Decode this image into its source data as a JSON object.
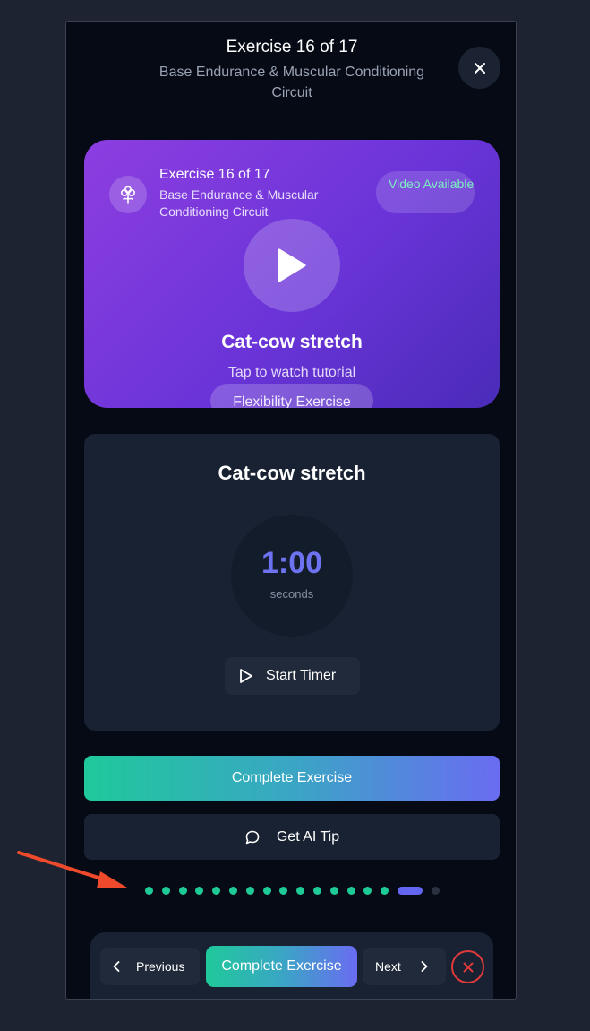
{
  "header": {
    "title": "Exercise 16 of 17",
    "subtitle": "Base Endurance & Muscular Conditioning Circuit"
  },
  "hero": {
    "title": "Exercise 16 of 17",
    "subtitle": "Base Endurance & Muscular Conditioning Circuit",
    "video_badge": "Video Available",
    "exercise_name": "Cat-cow stretch",
    "tap_text": "Tap to watch tutorial",
    "category_tag": "Flexibility Exercise"
  },
  "timer_card": {
    "exercise_name": "Cat-cow stretch",
    "time": "1:00",
    "unit": "seconds",
    "start_label": "Start Timer"
  },
  "actions": {
    "complete_label": "Complete Exercise",
    "tip_label": "Get AI Tip"
  },
  "progress": {
    "total": 17,
    "current": 16
  },
  "bottom_nav": {
    "previous_label": "Previous",
    "complete_label": "Complete Exercise",
    "next_label": "Next"
  },
  "colors": {
    "background": "#1e2331",
    "modal": "#050a14",
    "accent_green": "#1ecb96",
    "accent_indigo": "#6366f1",
    "hero_purple": "#8d3ee0",
    "danger": "#e03a3a",
    "annotation_arrow": "#ee4a2b"
  },
  "icons": {
    "close": "close-icon",
    "hero": "flower-icon",
    "play": "play-icon",
    "start": "play-outline-icon",
    "tip": "chat-bubble-icon",
    "prev": "chevron-left-icon",
    "next": "chevron-right-icon",
    "exit": "x-circle-icon"
  }
}
